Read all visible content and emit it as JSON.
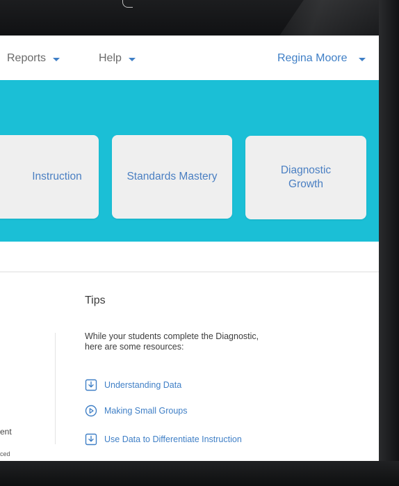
{
  "nav": {
    "reports_label": "Reports",
    "help_label": "Help",
    "user_name": "Regina Moore"
  },
  "cards": {
    "instruction": "Instruction",
    "standards_mastery": "Standards Mastery",
    "diagnostic_growth_line1": "Diagnostic",
    "diagnostic_growth_line2": "Growth"
  },
  "tips": {
    "title": "Tips",
    "description_line1": "While your students complete the Diagnostic,",
    "description_line2": "here are some resources:",
    "resources": [
      {
        "label": "Understanding Data",
        "icon": "download-icon"
      },
      {
        "label": "Making Small Groups",
        "icon": "play-circle-icon"
      },
      {
        "label": "Use Data to Differentiate Instruction",
        "icon": "download-icon"
      }
    ]
  },
  "left_fragments": {
    "text1": "ent",
    "text2": "ced"
  },
  "colors": {
    "banner": "#1bbfd6",
    "link": "#3f7fc6",
    "card_bg": "#efefef",
    "device": "#151617"
  }
}
